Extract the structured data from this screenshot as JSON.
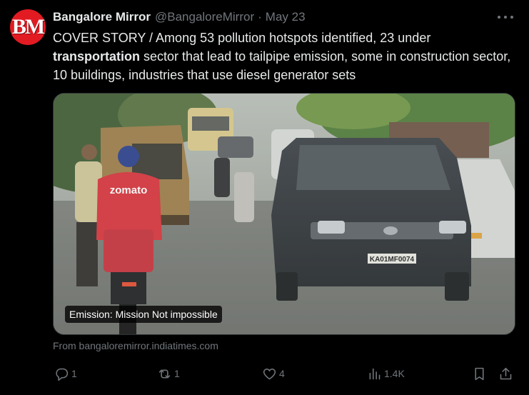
{
  "author": {
    "name": "Bangalore Mirror",
    "handle": "@BangaloreMirror",
    "separator": "·",
    "date": "May 23",
    "avatar_text": "BM",
    "avatar_color": "#e21b23"
  },
  "tweet": {
    "text_part1": "COVER STORY / Among 53 pollution hotspots identified, 23 under ",
    "text_bold": "transportation",
    "text_part2": " sector that lead to tailpipe emission, some in construction sector, 10 buildings, industries that use diesel generator sets"
  },
  "media": {
    "caption": "Emission: Mission Not impossible",
    "rider_brand": "zomato",
    "car_plate": "KA01MF0074"
  },
  "card": {
    "source": "From bangaloremirror.indiatimes.com"
  },
  "actions": {
    "reply_count": "1",
    "retweet_count": "1",
    "like_count": "4",
    "views_count": "1.4K"
  },
  "icons": {
    "more": "more-horizontal-icon",
    "reply": "reply-icon",
    "retweet": "retweet-icon",
    "like": "heart-icon",
    "views": "views-icon",
    "bookmark": "bookmark-icon",
    "share": "share-icon"
  }
}
